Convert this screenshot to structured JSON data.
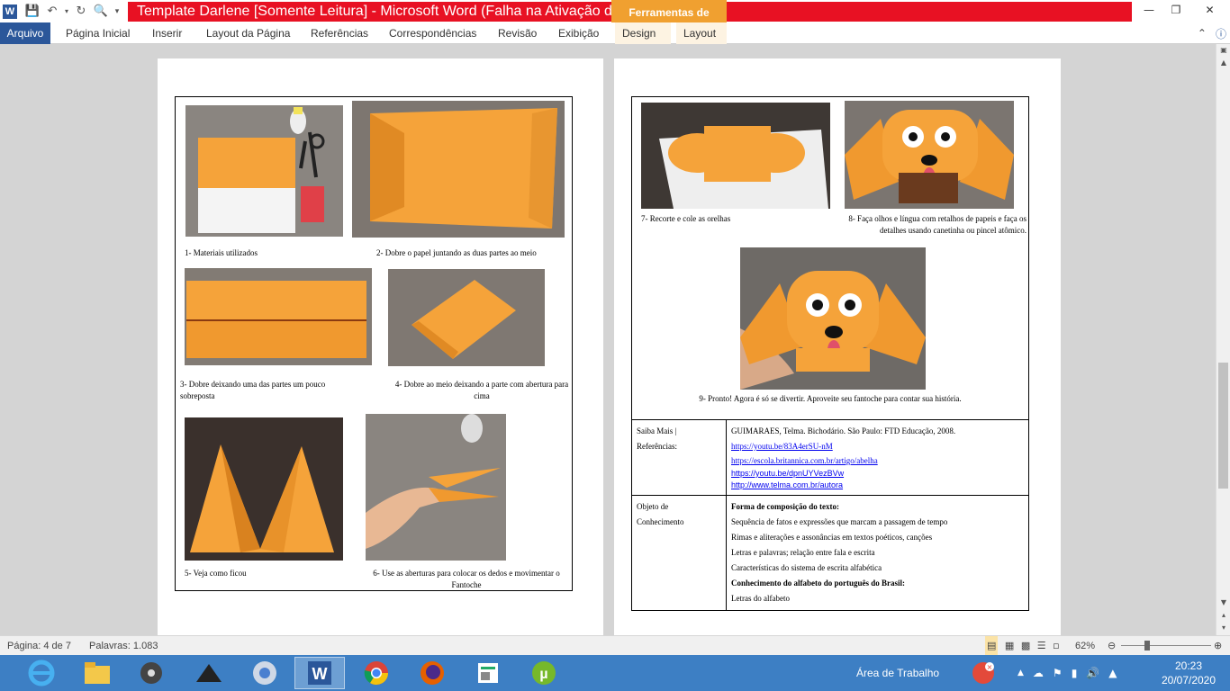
{
  "window": {
    "title": "Template Darlene [Somente Leitura]  -  Microsoft Word (Falha na Ativação d...",
    "context_group": "Ferramentas de Tabela"
  },
  "ribbon": {
    "tabs": [
      "Arquivo",
      "Página Inicial",
      "Inserir",
      "Layout da Página",
      "Referências",
      "Correspondências",
      "Revisão",
      "Exibição",
      "Design",
      "Layout"
    ]
  },
  "page1": {
    "captions": [
      "1- Materiais utilizados",
      "2- Dobre o papel juntando as duas partes ao meio",
      "3- Dobre deixando uma das partes um pouco sobreposta",
      "4- Dobre ao meio deixando a parte com abertura para cima",
      "5- Veja como ficou",
      "6- Use as aberturas para colocar os dedos e movimentar o Fantoche"
    ]
  },
  "page2": {
    "captions": [
      "7- Recorte e cole as orelhas",
      "8- Faça olhos e língua com retalhos de papeis e faça os  detalhes usando canetinha ou pincel atômico.",
      "9- Pronto! Agora é só se divertir. Aproveite seu fantoche para contar sua história."
    ],
    "saiba_mais": {
      "label_line1": "Saiba Mais |",
      "label_line2": "Referências:",
      "citation": "GUIMARAES, Telma. Bichodário. São Paulo: FTD Educação, 2008.",
      "links": [
        "https://youtu.be/83A4erSU-nM",
        "https://escola.britannica.com.br/artigo/abelha",
        "https://youtu.be/dpnUYVezBVw",
        "http://www.telma.com.br/autora"
      ]
    },
    "objeto": {
      "label_line1": "Objeto de",
      "label_line2": "Conhecimento",
      "heading1": "Forma de composição do texto:",
      "items1": [
        "Sequência de fatos e expressões que marcam a passagem de tempo",
        "Rimas e aliterações e assonâncias em textos poéticos, canções",
        "Letras e palavras; relação entre fala e escrita",
        "Características do sistema de escrita alfabética"
      ],
      "heading2": "Conhecimento do alfabeto do português do Brasil:",
      "items2": [
        "Letras do alfabeto"
      ]
    }
  },
  "status": {
    "page": "Página: 4 de 7",
    "words": "Palavras: 1.083",
    "zoom": "62%",
    "zoom_level": 0.62
  },
  "taskbar": {
    "desktop_label": "Área de Trabalho",
    "time": "20:23",
    "date": "20/07/2020"
  },
  "colors": {
    "title_red": "#e81123",
    "context_orange": "#f0a030",
    "file_blue": "#2b579a",
    "taskbar_blue": "#3d7fc4",
    "paper_orange": "#f5a33a"
  }
}
